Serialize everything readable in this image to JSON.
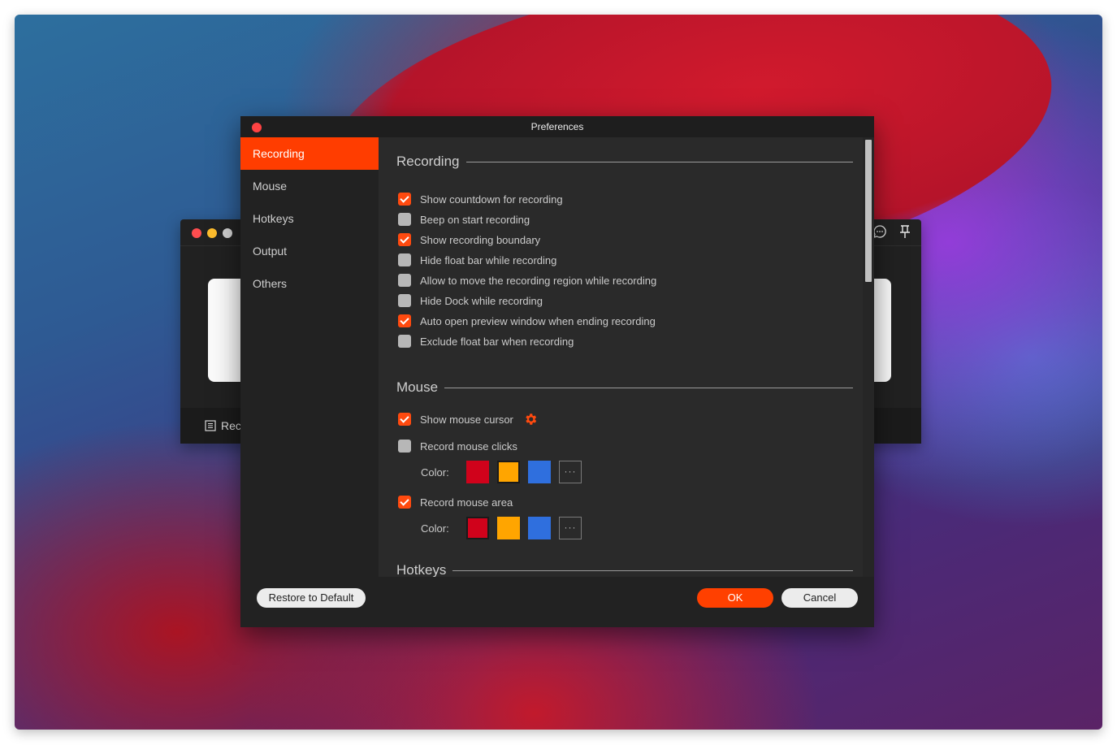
{
  "dialog": {
    "title": "Preferences"
  },
  "sidebar": {
    "items": [
      {
        "label": "Recording",
        "active": true
      },
      {
        "label": "Mouse",
        "active": false
      },
      {
        "label": "Hotkeys",
        "active": false
      },
      {
        "label": "Output",
        "active": false
      },
      {
        "label": "Others",
        "active": false
      }
    ]
  },
  "sections": {
    "recording": {
      "title": "Recording",
      "options": [
        {
          "label": "Show countdown for recording",
          "checked": true
        },
        {
          "label": "Beep on start recording",
          "checked": false
        },
        {
          "label": "Show recording boundary",
          "checked": true
        },
        {
          "label": "Hide float bar while recording",
          "checked": false
        },
        {
          "label": "Allow to move the recording region while recording",
          "checked": false
        },
        {
          "label": "Hide Dock while recording",
          "checked": false
        },
        {
          "label": "Auto open preview window when ending recording",
          "checked": true
        },
        {
          "label": "Exclude float bar when recording",
          "checked": false
        }
      ]
    },
    "mouse": {
      "title": "Mouse",
      "show_cursor": {
        "label": "Show mouse cursor",
        "checked": true,
        "settings_icon": "gear-icon"
      },
      "record_clicks": {
        "label": "Record mouse clicks",
        "checked": false
      },
      "clicks_color": {
        "label": "Color:",
        "swatches": [
          "#d0021b",
          "#ffa500",
          "#2f6fde"
        ],
        "selected": "#ffa500",
        "more_label": "···"
      },
      "record_area": {
        "label": "Record mouse area",
        "checked": true
      },
      "area_color": {
        "label": "Color:",
        "swatches": [
          "#d0021b",
          "#ffa500",
          "#2f6fde"
        ],
        "selected": "#d0021b",
        "more_label": "···"
      }
    },
    "hotkeys": {
      "title": "Hotkeys"
    }
  },
  "footer": {
    "restore_label": "Restore to Default",
    "ok_label": "OK",
    "cancel_label": "Cancel"
  },
  "background_window": {
    "bottom_label": "Rec",
    "icons": [
      "list-icon",
      "chat-icon",
      "pin-icon"
    ]
  },
  "colors": {
    "accent": "#ff3d00",
    "checkbox_on": "#ff4a0f",
    "checkbox_off": "#b7b7b7"
  }
}
